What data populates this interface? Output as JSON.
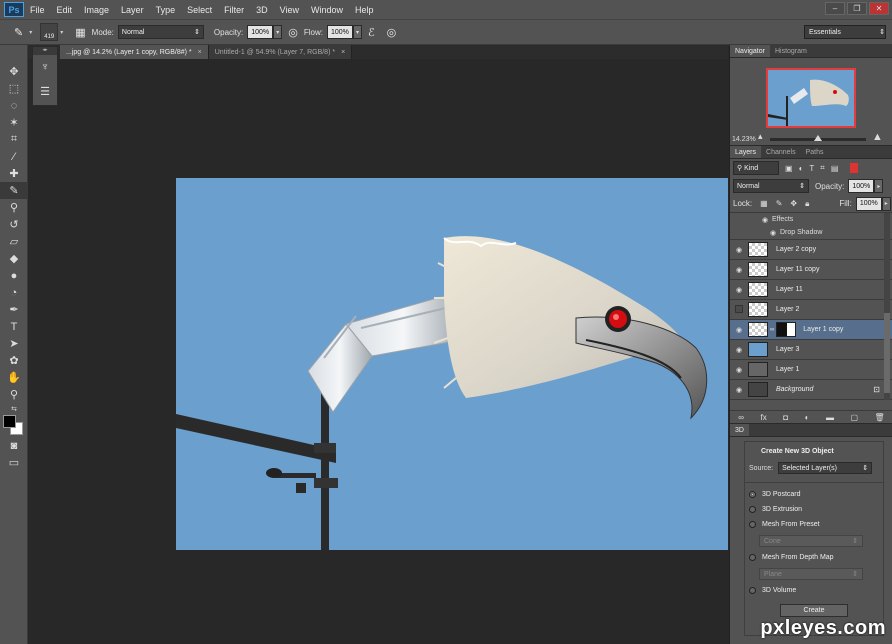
{
  "app": {
    "logo": "Ps"
  },
  "menu": [
    "File",
    "Edit",
    "Image",
    "Layer",
    "Type",
    "Select",
    "Filter",
    "3D",
    "View",
    "Window",
    "Help"
  ],
  "window_controls": [
    "–",
    "❐",
    "✕"
  ],
  "options": {
    "brush_size": "419",
    "mode_label": "Mode:",
    "mode_value": "Normal",
    "opacity_label": "Opacity:",
    "opacity_value": "100%",
    "flow_label": "Flow:",
    "flow_value": "100%",
    "workspace": "Essentials"
  },
  "tabs": [
    {
      "label": "...jpg @ 14.2% (Layer 1 copy, RGB/8#) *",
      "close": "×"
    },
    {
      "label": "Untitled-1 @ 54.9% (Layer 7, RGB/8) *",
      "close": "×"
    }
  ],
  "navigator": {
    "tabs": [
      "Navigator",
      "Histogram"
    ],
    "zoom": "14.23%"
  },
  "layers_panel": {
    "tabs": [
      "Layers",
      "Channels",
      "Paths"
    ],
    "filter_kind": "Kind",
    "blend_mode": "Normal",
    "opacity_label": "Opacity:",
    "opacity_value": "100%",
    "lock_label": "Lock:",
    "fill_label": "Fill:",
    "fill_value": "100%",
    "effects": "Effects",
    "drop_shadow": "Drop Shadow",
    "layers": [
      {
        "name": "Layer 2 copy",
        "visible": true,
        "selected": false
      },
      {
        "name": "Layer 11 copy",
        "visible": true,
        "selected": false
      },
      {
        "name": "Layer 11",
        "visible": true,
        "selected": false
      },
      {
        "name": "Layer 2",
        "visible": false,
        "selected": false
      },
      {
        "name": "Layer 1 copy",
        "visible": true,
        "selected": true
      },
      {
        "name": "Layer 3",
        "visible": true,
        "selected": false
      },
      {
        "name": "Layer 1",
        "visible": true,
        "selected": false
      },
      {
        "name": "Background",
        "visible": true,
        "selected": false
      }
    ]
  },
  "panel3d": {
    "tab": "3D",
    "title": "Create New 3D Object",
    "source_label": "Source:",
    "source_value": "Selected Layer(s)",
    "options": [
      "3D Postcard",
      "3D Extrusion",
      "Mesh From Preset",
      "Mesh From Depth Map",
      "3D Volume"
    ],
    "preset_value": "Cone",
    "depth_value": "Plane",
    "create_button": "Create"
  },
  "watermark": "pxleyes.com",
  "colors": {
    "accent_selected": "#576f8c",
    "sky": "#6b9fce",
    "ui_bg": "#535353",
    "canvas_bg": "#282828"
  }
}
